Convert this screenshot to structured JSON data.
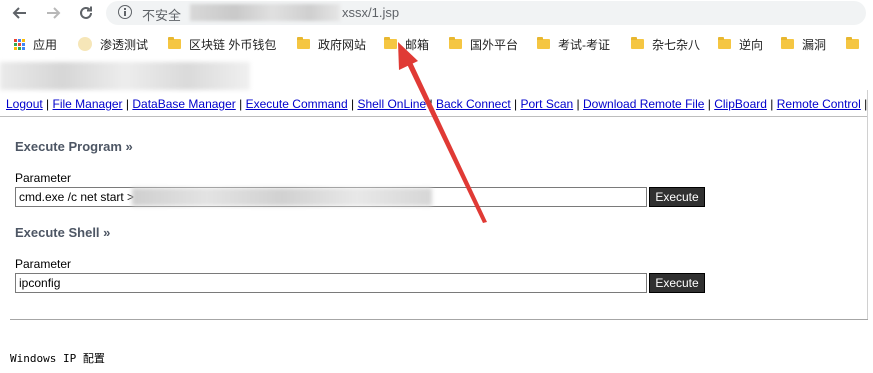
{
  "browser": {
    "security_label": "不安全",
    "url_visible": "xssx/1.jsp"
  },
  "bookmarks": {
    "apps_label": "应用",
    "items": [
      "渗透测试",
      "区块链 外币钱包",
      "政府网站",
      "邮箱",
      "国外平台",
      "考试-考证",
      "杂七杂八",
      "逆向",
      "漏洞"
    ]
  },
  "menu": {
    "links": [
      "Logout",
      "File Manager",
      "DataBase Manager",
      "Execute Command",
      "Shell OnLine",
      "Back Connect",
      "Port Scan",
      "Download Remote File",
      "ClipBoard",
      "Remote Control"
    ],
    "separator": "|"
  },
  "execute_program": {
    "title": "Execute Program »",
    "param_label": "Parameter",
    "value": "cmd.exe /c net start >",
    "button": "Execute"
  },
  "execute_shell": {
    "title": "Execute Shell »",
    "param_label": "Parameter",
    "value": "ipconfig",
    "button": "Execute"
  },
  "output": {
    "first_line": "Windows IP 配置"
  },
  "colors": {
    "link": "#0000cc",
    "section_title": "#4d5664",
    "button_bg": "#303030",
    "arrow": "#e03a35",
    "folder": "#f5c642"
  }
}
